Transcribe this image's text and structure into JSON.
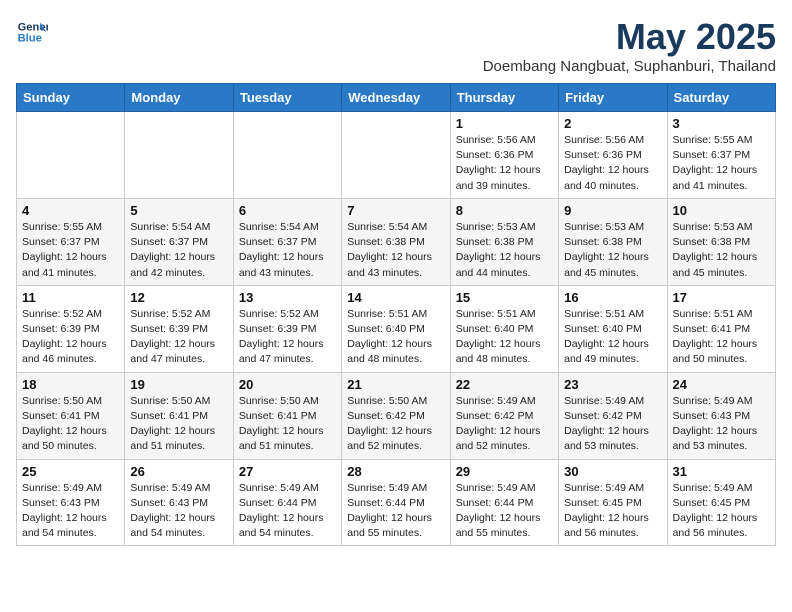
{
  "header": {
    "logo_line1": "General",
    "logo_line2": "Blue",
    "month_title": "May 2025",
    "location": "Doembang Nangbuat, Suphanburi, Thailand"
  },
  "weekdays": [
    "Sunday",
    "Monday",
    "Tuesday",
    "Wednesday",
    "Thursday",
    "Friday",
    "Saturday"
  ],
  "weeks": [
    [
      {
        "day": "",
        "info": ""
      },
      {
        "day": "",
        "info": ""
      },
      {
        "day": "",
        "info": ""
      },
      {
        "day": "",
        "info": ""
      },
      {
        "day": "1",
        "info": "Sunrise: 5:56 AM\nSunset: 6:36 PM\nDaylight: 12 hours\nand 39 minutes."
      },
      {
        "day": "2",
        "info": "Sunrise: 5:56 AM\nSunset: 6:36 PM\nDaylight: 12 hours\nand 40 minutes."
      },
      {
        "day": "3",
        "info": "Sunrise: 5:55 AM\nSunset: 6:37 PM\nDaylight: 12 hours\nand 41 minutes."
      }
    ],
    [
      {
        "day": "4",
        "info": "Sunrise: 5:55 AM\nSunset: 6:37 PM\nDaylight: 12 hours\nand 41 minutes."
      },
      {
        "day": "5",
        "info": "Sunrise: 5:54 AM\nSunset: 6:37 PM\nDaylight: 12 hours\nand 42 minutes."
      },
      {
        "day": "6",
        "info": "Sunrise: 5:54 AM\nSunset: 6:37 PM\nDaylight: 12 hours\nand 43 minutes."
      },
      {
        "day": "7",
        "info": "Sunrise: 5:54 AM\nSunset: 6:38 PM\nDaylight: 12 hours\nand 43 minutes."
      },
      {
        "day": "8",
        "info": "Sunrise: 5:53 AM\nSunset: 6:38 PM\nDaylight: 12 hours\nand 44 minutes."
      },
      {
        "day": "9",
        "info": "Sunrise: 5:53 AM\nSunset: 6:38 PM\nDaylight: 12 hours\nand 45 minutes."
      },
      {
        "day": "10",
        "info": "Sunrise: 5:53 AM\nSunset: 6:38 PM\nDaylight: 12 hours\nand 45 minutes."
      }
    ],
    [
      {
        "day": "11",
        "info": "Sunrise: 5:52 AM\nSunset: 6:39 PM\nDaylight: 12 hours\nand 46 minutes."
      },
      {
        "day": "12",
        "info": "Sunrise: 5:52 AM\nSunset: 6:39 PM\nDaylight: 12 hours\nand 47 minutes."
      },
      {
        "day": "13",
        "info": "Sunrise: 5:52 AM\nSunset: 6:39 PM\nDaylight: 12 hours\nand 47 minutes."
      },
      {
        "day": "14",
        "info": "Sunrise: 5:51 AM\nSunset: 6:40 PM\nDaylight: 12 hours\nand 48 minutes."
      },
      {
        "day": "15",
        "info": "Sunrise: 5:51 AM\nSunset: 6:40 PM\nDaylight: 12 hours\nand 48 minutes."
      },
      {
        "day": "16",
        "info": "Sunrise: 5:51 AM\nSunset: 6:40 PM\nDaylight: 12 hours\nand 49 minutes."
      },
      {
        "day": "17",
        "info": "Sunrise: 5:51 AM\nSunset: 6:41 PM\nDaylight: 12 hours\nand 50 minutes."
      }
    ],
    [
      {
        "day": "18",
        "info": "Sunrise: 5:50 AM\nSunset: 6:41 PM\nDaylight: 12 hours\nand 50 minutes."
      },
      {
        "day": "19",
        "info": "Sunrise: 5:50 AM\nSunset: 6:41 PM\nDaylight: 12 hours\nand 51 minutes."
      },
      {
        "day": "20",
        "info": "Sunrise: 5:50 AM\nSunset: 6:41 PM\nDaylight: 12 hours\nand 51 minutes."
      },
      {
        "day": "21",
        "info": "Sunrise: 5:50 AM\nSunset: 6:42 PM\nDaylight: 12 hours\nand 52 minutes."
      },
      {
        "day": "22",
        "info": "Sunrise: 5:49 AM\nSunset: 6:42 PM\nDaylight: 12 hours\nand 52 minutes."
      },
      {
        "day": "23",
        "info": "Sunrise: 5:49 AM\nSunset: 6:42 PM\nDaylight: 12 hours\nand 53 minutes."
      },
      {
        "day": "24",
        "info": "Sunrise: 5:49 AM\nSunset: 6:43 PM\nDaylight: 12 hours\nand 53 minutes."
      }
    ],
    [
      {
        "day": "25",
        "info": "Sunrise: 5:49 AM\nSunset: 6:43 PM\nDaylight: 12 hours\nand 54 minutes."
      },
      {
        "day": "26",
        "info": "Sunrise: 5:49 AM\nSunset: 6:43 PM\nDaylight: 12 hours\nand 54 minutes."
      },
      {
        "day": "27",
        "info": "Sunrise: 5:49 AM\nSunset: 6:44 PM\nDaylight: 12 hours\nand 54 minutes."
      },
      {
        "day": "28",
        "info": "Sunrise: 5:49 AM\nSunset: 6:44 PM\nDaylight: 12 hours\nand 55 minutes."
      },
      {
        "day": "29",
        "info": "Sunrise: 5:49 AM\nSunset: 6:44 PM\nDaylight: 12 hours\nand 55 minutes."
      },
      {
        "day": "30",
        "info": "Sunrise: 5:49 AM\nSunset: 6:45 PM\nDaylight: 12 hours\nand 56 minutes."
      },
      {
        "day": "31",
        "info": "Sunrise: 5:49 AM\nSunset: 6:45 PM\nDaylight: 12 hours\nand 56 minutes."
      }
    ]
  ]
}
